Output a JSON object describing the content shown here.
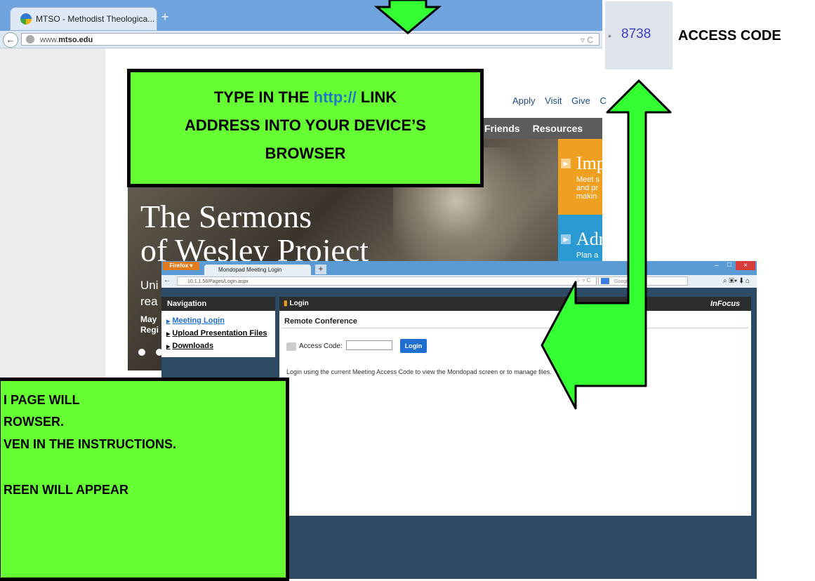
{
  "browser1": {
    "tab_title": "MTSO - Methodist Theologica...",
    "new_tab": "+",
    "url_prefix": "www.",
    "url_domain": "mtso.edu",
    "url_controls": "▿ C",
    "back_glyph": "←"
  },
  "site": {
    "top_links": [
      "Apply",
      "Visit",
      "Give",
      "C"
    ],
    "nav_items": [
      "Friends",
      "Resources"
    ],
    "hero_title_1": "The Sermons",
    "hero_title_2": "of Wesley Project",
    "hero_line_1": "Uni",
    "hero_line_2": "rea",
    "hero_line_3": "May",
    "hero_line_4": "Regi",
    "promo1_heading": "Imp",
    "promo1_lines": [
      "Meet s",
      "and pr",
      "makin"
    ],
    "promo2_heading": "Adr",
    "promo2_lines": [
      "Plan a"
    ]
  },
  "browser2": {
    "firefox_button": "Firefox ▾",
    "tab_title": "Mondopad Meeting Login",
    "new_tab": "+",
    "url": "10.1.1.58/Pages/Login.aspx",
    "url_controls": "☆ ▿ C",
    "search_placeholder": "Google",
    "window_min": "–",
    "window_max": "□",
    "window_close": "×",
    "toolbar_icons": "⌕ ▣▾ ⬇ ⌂"
  },
  "mondopad": {
    "nav_title": "Navigation",
    "nav_items": [
      "Meeting Login",
      "Upload Presentation Files",
      "Downloads"
    ],
    "login_title": "Login",
    "brand": "InFocus",
    "section_title": "Remote Conference",
    "access_label": "Access Code:",
    "login_button": "Login",
    "help_text": "Login using the current Meeting Access Code to view the Mondopad screen or to manage files."
  },
  "callout_top": {
    "line1_a": "TYPE IN THE ",
    "line1_link": "http://",
    "line1_b": " LINK",
    "line2": "ADDRESS INTO YOUR DEVICE’S",
    "line3": "BROWSER"
  },
  "callout_bottom": {
    "lines": [
      "I PAGE WILL",
      "ROWSER.",
      "VEN IN THE INSTRUCTIONS.",
      "",
      "REEN WILL APPEAR"
    ]
  },
  "access_code": {
    "code": "8738",
    "caption": "ACCESS CODE"
  },
  "colors": {
    "callout_green": "#66ff33",
    "link_blue": "#2279c2",
    "arrow_green": "#33ff33"
  }
}
